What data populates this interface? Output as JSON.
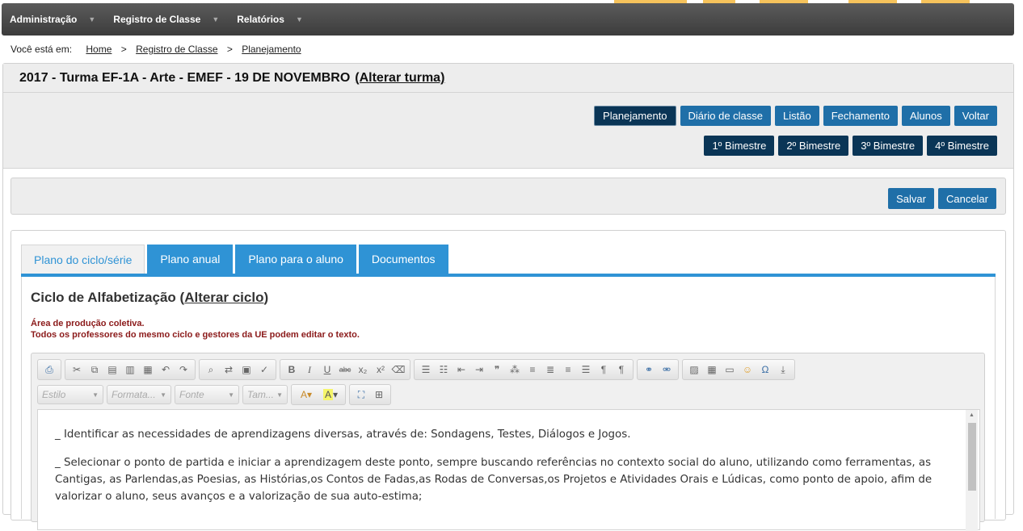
{
  "topnav": {
    "items": [
      {
        "label": "Administração"
      },
      {
        "label": "Registro de Classe"
      },
      {
        "label": "Relatórios"
      }
    ]
  },
  "breadcrumb": {
    "prefix": "Você está em:",
    "items": [
      "Home",
      "Registro de Classe",
      "Planejamento"
    ],
    "separator": ">"
  },
  "header": {
    "title": "2017 - Turma EF-1A - Arte - EMEF - 19 DE NOVEMBRO",
    "change_link": "(Alterar turma)"
  },
  "nav_buttons": [
    "Planejamento",
    "Diário de classe",
    "Listão",
    "Fechamento",
    "Alunos",
    "Voltar"
  ],
  "bimester_buttons": [
    "1º Bimestre",
    "2º Bimestre",
    "3º Bimestre",
    "4º Bimestre"
  ],
  "actions": {
    "save": "Salvar",
    "cancel": "Cancelar"
  },
  "tabs": [
    "Plano do ciclo/série",
    "Plano anual",
    "Plano para o aluno",
    "Documentos"
  ],
  "cycle": {
    "title_prefix": "Ciclo de Alfabetização (",
    "change_link": "Alterar ciclo",
    "title_suffix": ")"
  },
  "notice": {
    "line1": "Área de produção coletiva.",
    "line2": "Todos os professores do mesmo ciclo e gestores da UE podem editar o texto."
  },
  "editor": {
    "combos": {
      "style": "Estilo",
      "format": "Formata...",
      "font": "Fonte",
      "size": "Tam..."
    },
    "paragraphs": [
      "_ Identificar as necessidades de aprendizagens diversas,  através de:  Sondagens, Testes, Diálogos e Jogos.",
      "_ Selecionar o ponto de partida e iniciar a aprendizagem deste ponto, sempre buscando referências no contexto social do aluno, utilizando como ferramentas, as Cantigas, as Parlendas,as Poesias, as  Histórias,os  Contos de Fadas,as Rodas de Conversas,os  Projetos e Atividades Orais e Lúdicas, como ponto de apoio, afim de valorizar o aluno, seus avanços  e a  valorização de sua auto-estima;"
    ]
  },
  "colors": {
    "nav_bg": "#4a4a4a",
    "button_blue": "#1f6fa8",
    "button_dark": "#0a3556",
    "tab_blue": "#2f93d5",
    "notice_red": "#8b1a1a"
  }
}
